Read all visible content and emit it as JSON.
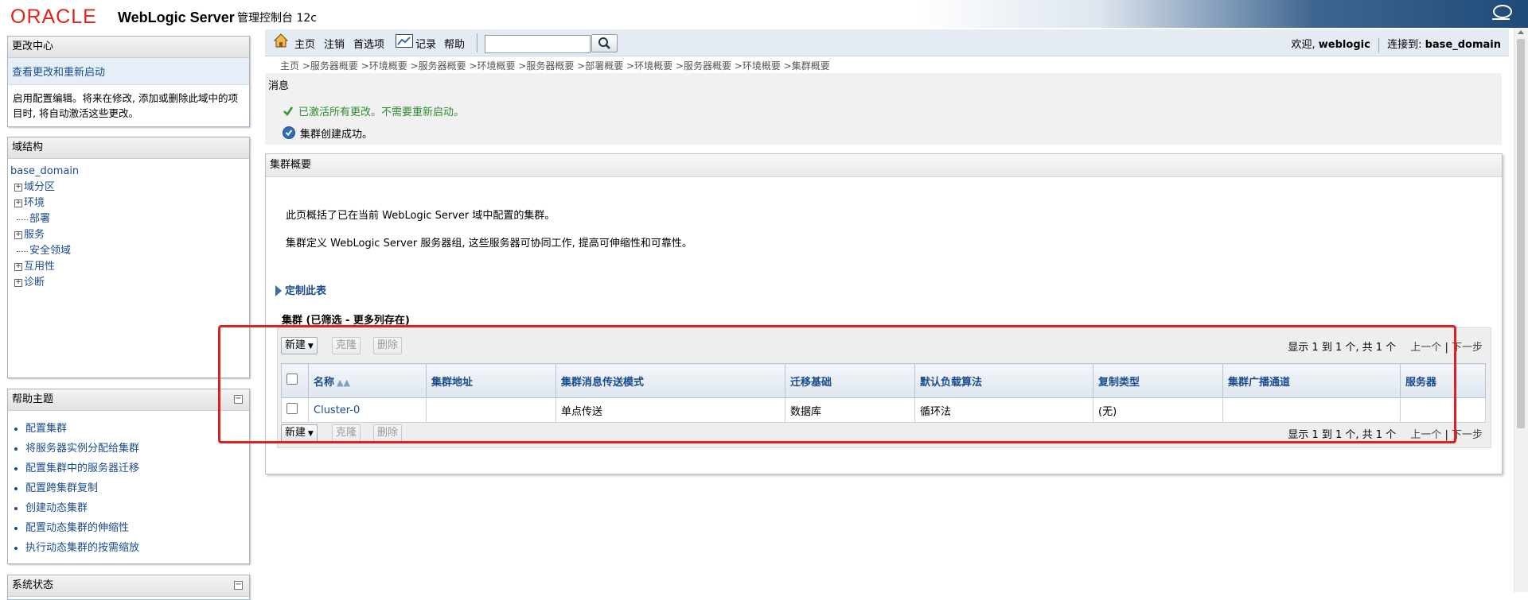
{
  "header": {
    "logo": "ORACLE",
    "product": "WebLogic Server",
    "product_sub": "管理控制台 12c"
  },
  "change_center": {
    "title": "更改中心",
    "link": "查看更改和重新启动",
    "text": "启用配置编辑。将来在修改, 添加或删除此域中的项目时, 将自动激活这些更改。"
  },
  "domain_structure": {
    "title": "域结构",
    "root": "base_domain",
    "items": [
      {
        "label": "域分区",
        "expandable": true
      },
      {
        "label": "环境",
        "expandable": true
      },
      {
        "label": "部署",
        "expandable": false
      },
      {
        "label": "服务",
        "expandable": true
      },
      {
        "label": "安全领域",
        "expandable": false
      },
      {
        "label": "互用性",
        "expandable": true
      },
      {
        "label": "诊断",
        "expandable": true
      }
    ]
  },
  "help_topics": {
    "title": "帮助主题",
    "collapse": "⊟",
    "items": [
      "配置集群",
      "将服务器实例分配给集群",
      "配置集群中的服务器迁移",
      "配置跨集群复制",
      "创建动态集群",
      "配置动态集群的伸缩性",
      "执行动态集群的按需缩放"
    ]
  },
  "system_status": {
    "title": "系统状态",
    "collapse": "⊟"
  },
  "toolbar": {
    "home": "主页",
    "logout": "注销",
    "preferences": "首选项",
    "record": "记录",
    "help": "帮助",
    "search_value": "",
    "welcome_prefix": "欢迎, ",
    "user": "weblogic",
    "connected_prefix": "连接到: ",
    "domain": "base_domain"
  },
  "breadcrumb": "主页 >服务器概要 >环境概要 >服务器概要 >环境概要 >服务器概要 >部署概要 >环境概要 >服务器概要 >环境概要 >集群概要",
  "messages": {
    "title": "消息",
    "success": "已激活所有更改。不需要重新启动。",
    "info": "集群创建成功。",
    "colors": {
      "success": "#2e8b2e",
      "info": "#2f6db5"
    }
  },
  "content": {
    "title": "集群概要",
    "desc1": "此页概括了已在当前 WebLogic Server 域中配置的集群。",
    "desc2": "集群定义 WebLogic Server 服务器组, 这些服务器可协同工作, 提高可伸缩性和可靠性。",
    "customize": "定制此表",
    "table_caption": "集群 (已筛选 - 更多列存在)",
    "buttons": {
      "new": "新建",
      "clone": "克隆",
      "delete": "删除"
    },
    "pager": {
      "text": "显示 1 到 1 个, 共 1 个",
      "prev": "上一个",
      "sep": "|",
      "next": "下一步"
    },
    "columns": [
      "名称",
      "集群地址",
      "集群消息传送模式",
      "迁移基础",
      "默认负载算法",
      "复制类型",
      "集群广播通道",
      "服务器"
    ],
    "rows": [
      {
        "name": "Cluster-0",
        "address": "",
        "messaging_mode": "单点传送",
        "migration_basis": "数据库",
        "load_algorithm": "循环法",
        "replication_type": "(无)",
        "broadcast_channel": "",
        "servers": ""
      }
    ]
  },
  "highlight_color": "#e02020"
}
